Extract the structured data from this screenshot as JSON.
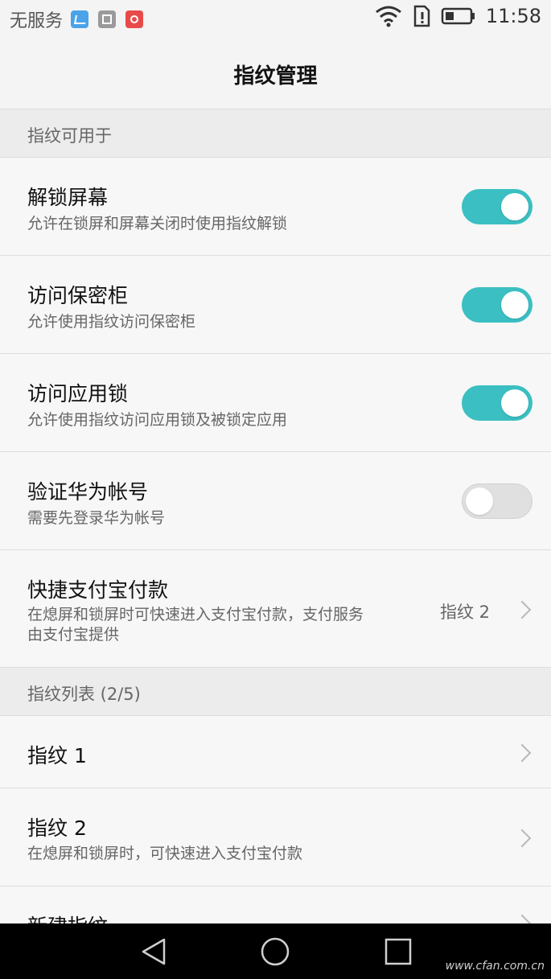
{
  "status_bar": {
    "carrier": "无服务",
    "time": "11:58"
  },
  "header": {
    "title": "指纹管理"
  },
  "sections": {
    "usage_header": "指纹可用于",
    "list_header": "指纹列表 (2/5)"
  },
  "usage_items": [
    {
      "title": "解锁屏幕",
      "subtitle": "允许在锁屏和屏幕关闭时使用指纹解锁",
      "enabled": true
    },
    {
      "title": "访问保密柜",
      "subtitle": "允许使用指纹访问保密柜",
      "enabled": true
    },
    {
      "title": "访问应用锁",
      "subtitle": "允许使用指纹访问应用锁及被锁定应用",
      "enabled": true
    },
    {
      "title": "验证华为帐号",
      "subtitle": "需要先登录华为帐号",
      "enabled": false
    }
  ],
  "alipay": {
    "title": "快捷支付宝付款",
    "subtitle_line1": "在熄屏和锁屏时可快速进入支付宝付款，支付服务",
    "subtitle_line2": "由支付宝提供",
    "value": "指纹 2"
  },
  "fingerprints": [
    {
      "title": "指纹 1"
    },
    {
      "title": "指纹 2",
      "subtitle": "在熄屏和锁屏时，可快速进入支付宝付款"
    }
  ],
  "new_fingerprint": {
    "title": "新建指纹"
  },
  "watermark": "www.cfan.com.cn",
  "colors": {
    "toggle_on": "#3bbfc2",
    "toggle_off": "#e0e0e0"
  }
}
